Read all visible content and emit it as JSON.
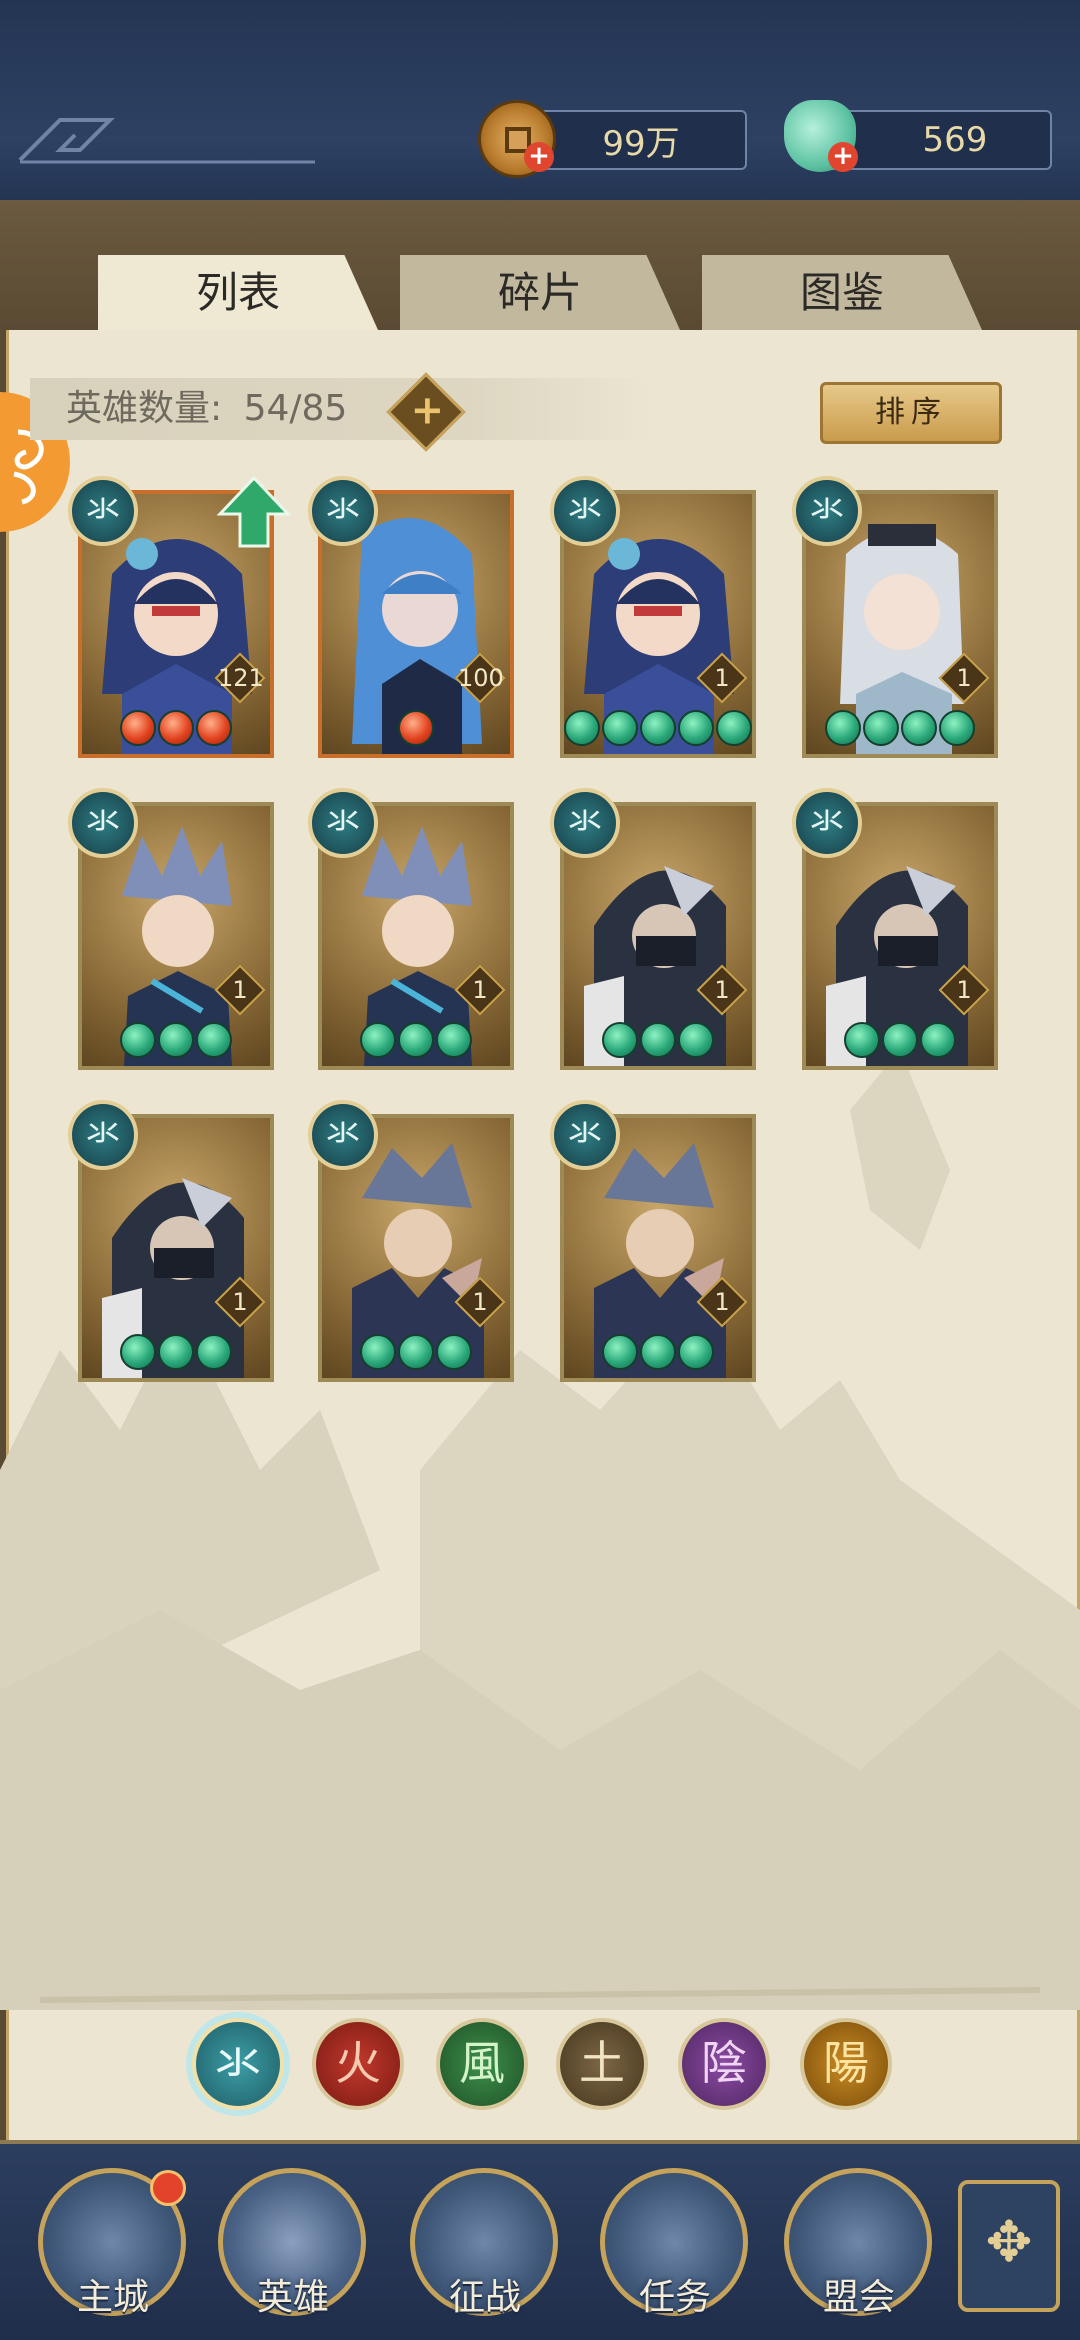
{
  "header": {
    "copper": {
      "icon": "copper-coin-icon",
      "value": "99万"
    },
    "jade": {
      "icon": "jade-pouch-icon",
      "value": "569"
    }
  },
  "tabs": [
    {
      "label": "列表",
      "active": true
    },
    {
      "label": "碎片",
      "active": false
    },
    {
      "label": "图鉴",
      "active": false
    }
  ],
  "hero_count": {
    "label": "英雄数量:",
    "value": "54/85"
  },
  "sort_button": "排序",
  "heroes": [
    {
      "element": "氺",
      "level": "121",
      "stars": 3,
      "star_color": "red",
      "portrait": "blue-hair-lady-masked",
      "upgrade": true
    },
    {
      "element": "氺",
      "level": "100",
      "stars": 1,
      "star_color": "red",
      "portrait": "long-blue-hair-maiden",
      "upgrade": false
    },
    {
      "element": "氺",
      "level": "1",
      "stars": 5,
      "star_color": "green",
      "portrait": "blue-hair-lady-masked",
      "upgrade": false
    },
    {
      "element": "氺",
      "level": "1",
      "stars": 4,
      "star_color": "green",
      "portrait": "white-hair-lady",
      "upgrade": false
    },
    {
      "element": "氺",
      "level": "1",
      "stars": 3,
      "star_color": "green",
      "portrait": "spiky-hair-swordsman",
      "upgrade": false
    },
    {
      "element": "氺",
      "level": "1",
      "stars": 3,
      "star_color": "green",
      "portrait": "spiky-hair-swordsman",
      "upgrade": false
    },
    {
      "element": "氺",
      "level": "1",
      "stars": 3,
      "star_color": "green",
      "portrait": "hooded-ninja",
      "upgrade": false
    },
    {
      "element": "氺",
      "level": "1",
      "stars": 3,
      "star_color": "green",
      "portrait": "hooded-ninja",
      "upgrade": false
    },
    {
      "element": "氺",
      "level": "1",
      "stars": 3,
      "star_color": "green",
      "portrait": "hooded-ninja",
      "upgrade": false
    },
    {
      "element": "氺",
      "level": "1",
      "stars": 3,
      "star_color": "green",
      "portrait": "armored-warrior",
      "upgrade": false
    },
    {
      "element": "氺",
      "level": "1",
      "stars": 3,
      "star_color": "green",
      "portrait": "armored-warrior",
      "upgrade": false
    }
  ],
  "element_filters": [
    {
      "glyph": "氺",
      "key": "water",
      "selected": true
    },
    {
      "glyph": "火",
      "key": "fire",
      "selected": false
    },
    {
      "glyph": "風",
      "key": "wind",
      "selected": false
    },
    {
      "glyph": "土",
      "key": "earth",
      "selected": false
    },
    {
      "glyph": "陰",
      "key": "yin",
      "selected": false
    },
    {
      "glyph": "陽",
      "key": "yang",
      "selected": false
    }
  ],
  "bottom_nav": [
    {
      "label": "主城",
      "icon": "palace-icon",
      "badge": true
    },
    {
      "label": "英雄",
      "icon": "hero-portrait-icon",
      "badge": false,
      "active": true
    },
    {
      "label": "征战",
      "icon": "battle-drum-icon",
      "badge": false
    },
    {
      "label": "任务",
      "icon": "quest-scroll-icon",
      "badge": false
    },
    {
      "label": "盟会",
      "icon": "alliance-gate-icon",
      "badge": false
    }
  ],
  "colors": {
    "water": "#2f7d84",
    "gold": "#c9a24a",
    "nav": "#2c3e5f",
    "parchment": "#ebe5d1"
  }
}
